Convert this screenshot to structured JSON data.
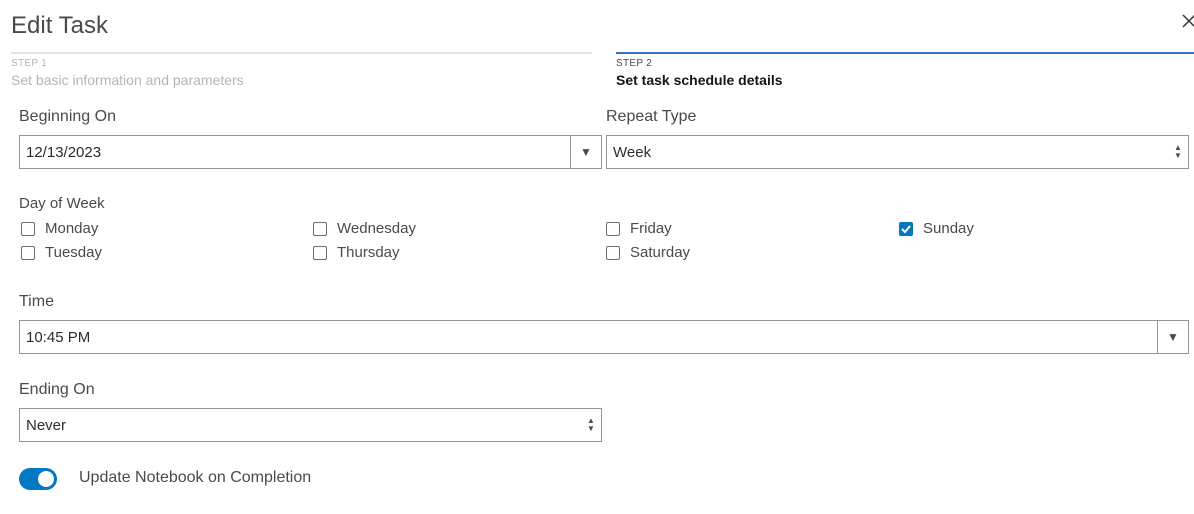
{
  "dialog": {
    "title": "Edit Task",
    "close_icon": "close-icon"
  },
  "steps": [
    {
      "number": "STEP 1",
      "description": "Set basic information and parameters",
      "state": "inactive"
    },
    {
      "number": "STEP 2",
      "description": "Set task schedule details",
      "state": "active"
    }
  ],
  "beginning_on": {
    "label": "Beginning On",
    "value": "12/13/2023",
    "icon": "caret-down-icon"
  },
  "repeat_type": {
    "label": "Repeat Type",
    "value": "Week",
    "icon": "spinner-icon"
  },
  "day_of_week": {
    "label": "Day of Week",
    "days": [
      {
        "label": "Monday",
        "checked": false
      },
      {
        "label": "Tuesday",
        "checked": false
      },
      {
        "label": "Wednesday",
        "checked": false
      },
      {
        "label": "Thursday",
        "checked": false
      },
      {
        "label": "Friday",
        "checked": false
      },
      {
        "label": "Saturday",
        "checked": false
      },
      {
        "label": "Sunday",
        "checked": true
      }
    ]
  },
  "time": {
    "label": "Time",
    "value": "10:45 PM",
    "icon": "caret-down-icon"
  },
  "ending_on": {
    "label": "Ending On",
    "value": "Never",
    "icon": "spinner-icon"
  },
  "update_notebook": {
    "label": "Update Notebook on Completion",
    "enabled": true
  },
  "colors": {
    "accent": "#0079c1",
    "active_step": "#2f7bbf",
    "inactive_text": "#b4b4b4"
  }
}
